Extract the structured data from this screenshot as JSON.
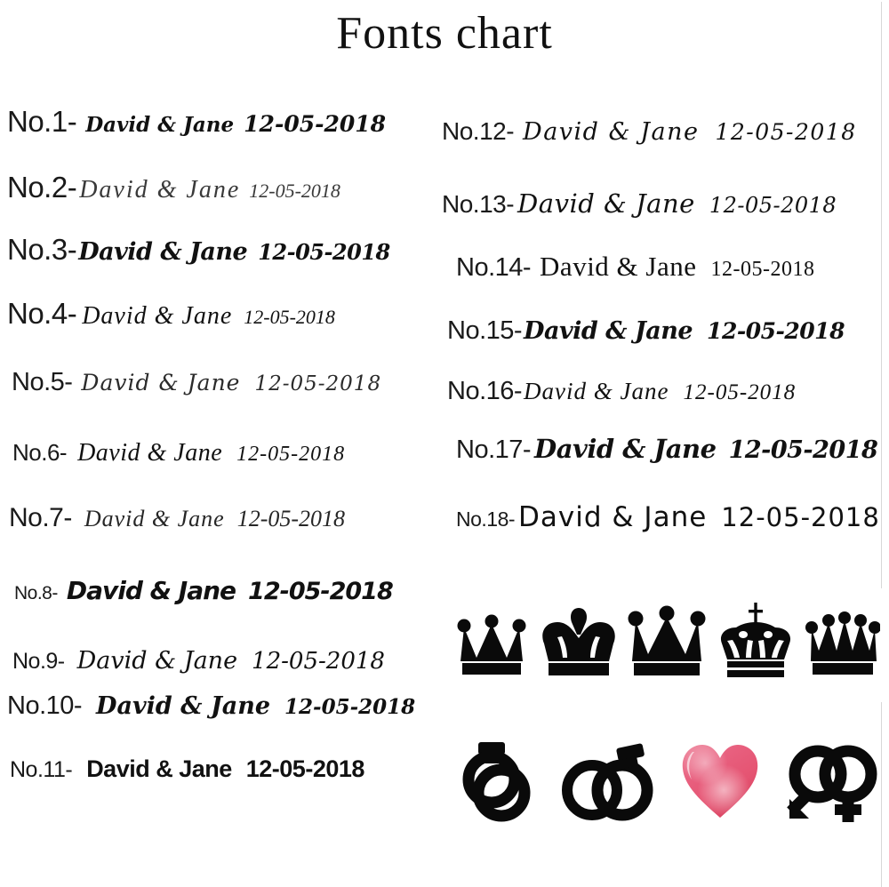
{
  "title": "Fonts chart",
  "sample": {
    "names": "David & Jane",
    "date": "12-05-2018"
  },
  "columns": {
    "left": [
      {
        "label": "No.1-",
        "names": "David & Jane",
        "date": "12-05-2018"
      },
      {
        "label": "No.2-",
        "names": "David & Jane",
        "date": "12-05-2018"
      },
      {
        "label": "No.3-",
        "names": "David & Jane",
        "date": "12-05-2018"
      },
      {
        "label": "No.4-",
        "names": "David & Jane",
        "date": "12-05-2018"
      },
      {
        "label": "No.5-",
        "names": "David & Jane",
        "date": "12-05-2018"
      },
      {
        "label": "No.6-",
        "names": "David & Jane",
        "date": "12-05-2018"
      },
      {
        "label": "No.7-",
        "names": "David & Jane",
        "date": "12-05-2018"
      },
      {
        "label": "No.8-",
        "names": "David & Jane",
        "date": "12-05-2018"
      },
      {
        "label": "No.9-",
        "names": "David & Jane",
        "date": "12-05-2018"
      },
      {
        "label": "No.10-",
        "names": "David & Jane",
        "date": "12-05-2018"
      },
      {
        "label": "No.11-",
        "names": "David & Jane",
        "date": "12-05-2018"
      }
    ],
    "right": [
      {
        "label": "No.12-",
        "names": "David & Jane",
        "date": "12-05-2018"
      },
      {
        "label": "No.13-",
        "names": "David & Jane",
        "date": "12-05-2018"
      },
      {
        "label": "No.14-",
        "names": "David & Jane",
        "date": "12-05-2018"
      },
      {
        "label": "No.15-",
        "names": "David & Jane",
        "date": "12-05-2018"
      },
      {
        "label": "No.16-",
        "names": "David & Jane",
        "date": "12-05-2018"
      },
      {
        "label": "No.17-",
        "names": "David & Jane",
        "date": "12-05-2018"
      },
      {
        "label": "No.18-",
        "names": "David & Jane",
        "date": "12-05-2018"
      }
    ]
  },
  "icons": {
    "crowns": [
      "crown-three-point-icon",
      "crown-rounded-icon",
      "crown-tall-three-point-icon",
      "crown-royal-cross-icon",
      "crown-five-point-icon"
    ],
    "symbols": [
      "wedding-rings-overlap-icon",
      "wedding-rings-interlocked-icon",
      "heart-watercolor-icon",
      "gender-symbols-interlocked-icon"
    ]
  },
  "colors": {
    "ink": "#111111",
    "background": "#ffffff",
    "heart_pink": "#e8607f",
    "heart_pink_light": "#f294a8",
    "heart_pink_dark": "#d8415f"
  }
}
